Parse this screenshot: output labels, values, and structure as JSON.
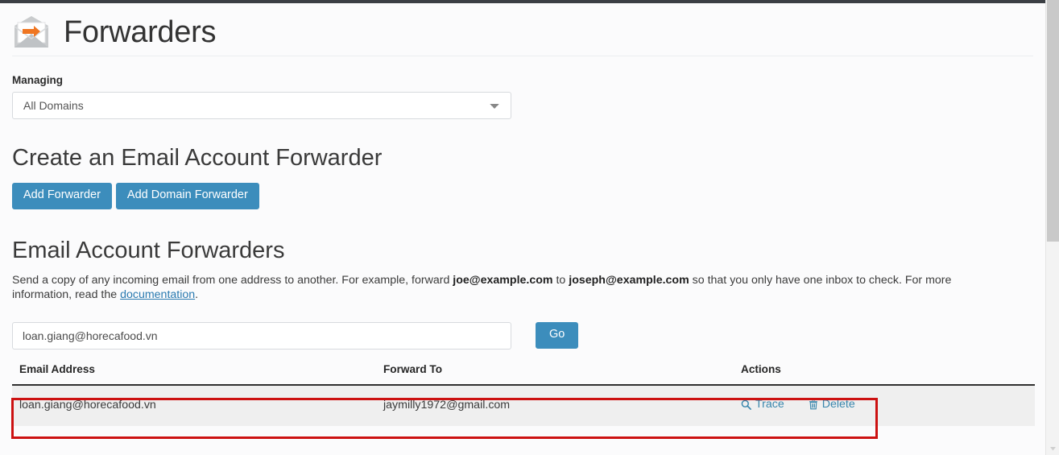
{
  "header": {
    "title": "Forwarders",
    "icon": "envelope-forward-icon"
  },
  "managing": {
    "label": "Managing",
    "selected": "All Domains",
    "options": [
      "All Domains"
    ]
  },
  "create": {
    "title": "Create an Email Account Forwarder",
    "add_forwarder_label": "Add Forwarder",
    "add_domain_forwarder_label": "Add Domain Forwarder"
  },
  "list": {
    "title": "Email Account Forwarders",
    "desc_part1": "Send a copy of any incoming email from one address to another. For example, forward ",
    "desc_email_from": "joe@example.com",
    "desc_part2": " to ",
    "desc_email_to": "joseph@example.com",
    "desc_part3": " so that you only have one inbox to check. For more information, read the ",
    "desc_link": "documentation",
    "desc_part4": "."
  },
  "search": {
    "value": "loan.giang@horecafood.vn",
    "placeholder": "",
    "go_label": "Go"
  },
  "table": {
    "columns": [
      "Email Address",
      "Forward To",
      "Actions"
    ],
    "rows": [
      {
        "email": "loan.giang@horecafood.vn",
        "forward_to": "jaymilly1972@gmail.com",
        "trace_label": "Trace",
        "delete_label": "Delete"
      }
    ]
  },
  "colors": {
    "accent_blue": "#3c8dbc",
    "link_blue": "#3a87ad",
    "highlight_red": "#cc1111",
    "icon_orange": "#ef7622"
  }
}
